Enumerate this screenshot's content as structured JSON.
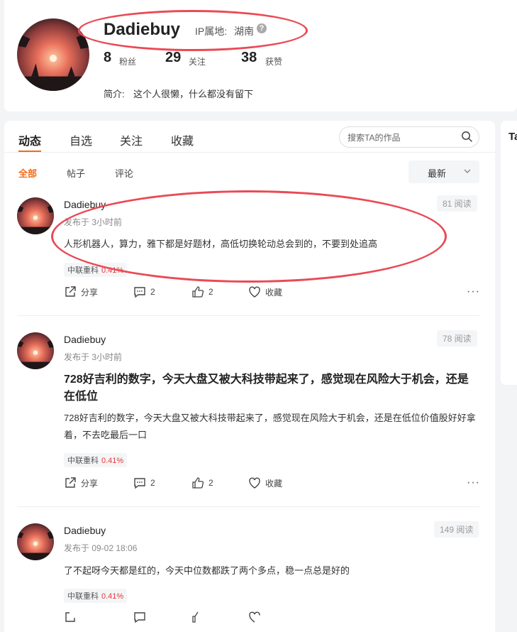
{
  "profile": {
    "username": "Dadiebuy",
    "ip_label": "IP属地:",
    "ip_location": "湖南",
    "stats": [
      {
        "value": "8",
        "label": "粉丝"
      },
      {
        "value": "29",
        "label": "关注"
      },
      {
        "value": "38",
        "label": "获赞"
      }
    ],
    "bio_label": "简介:",
    "bio": "这个人很懒，什么都没有留下"
  },
  "right_panel": {
    "title_fragment": "Ta"
  },
  "tabs": [
    {
      "label": "动态",
      "active": true
    },
    {
      "label": "自选",
      "active": false
    },
    {
      "label": "关注",
      "active": false
    },
    {
      "label": "收藏",
      "active": false
    }
  ],
  "search": {
    "placeholder": "搜索TA的作品",
    "icon": "search-icon"
  },
  "subtabs": [
    {
      "label": "全部",
      "active": true
    },
    {
      "label": "帖子",
      "active": false
    },
    {
      "label": "评论",
      "active": false
    }
  ],
  "sort": {
    "label": "最新",
    "icon": "chevron-down-icon"
  },
  "posts": [
    {
      "author": "Dadiebuy",
      "time": "发布于 3小时前",
      "reads": "81 阅读",
      "title": "",
      "body": "人形机器人，算力，雅下都是好题材，高低切换轮动总会到的，不要到处追高",
      "stock_name": "中联重科",
      "stock_change": "0.41%",
      "share": "分享",
      "comments": "2",
      "likes": "2",
      "favorite": "收藏"
    },
    {
      "author": "Dadiebuy",
      "time": "发布于 3小时前",
      "reads": "78 阅读",
      "title": "728好吉利的数字，今天大盘又被大科技带起来了，感觉现在风险大于机会，还是在低位",
      "body": "728好吉利的数字，今天大盘又被大科技带起来了，感觉现在风险大于机会，还是在低位价值股好好拿着，不去吃最后一口",
      "stock_name": "中联重科",
      "stock_change": "0.41%",
      "share": "分享",
      "comments": "2",
      "likes": "2",
      "favorite": "收藏"
    },
    {
      "author": "Dadiebuy",
      "time": "发布于 09-02 18:06",
      "reads": "149 阅读",
      "title": "",
      "body": "了不起呀今天都是红的，今天中位数都跌了两个多点，稳一点总是好的",
      "stock_name": "中联重科",
      "stock_change": "0.41%",
      "share": "分享",
      "comments": "",
      "likes": "",
      "favorite": ""
    }
  ],
  "colors": {
    "accent": "#f26b1d",
    "annotation": "#ea4a55",
    "rise": "#e23a3a"
  }
}
